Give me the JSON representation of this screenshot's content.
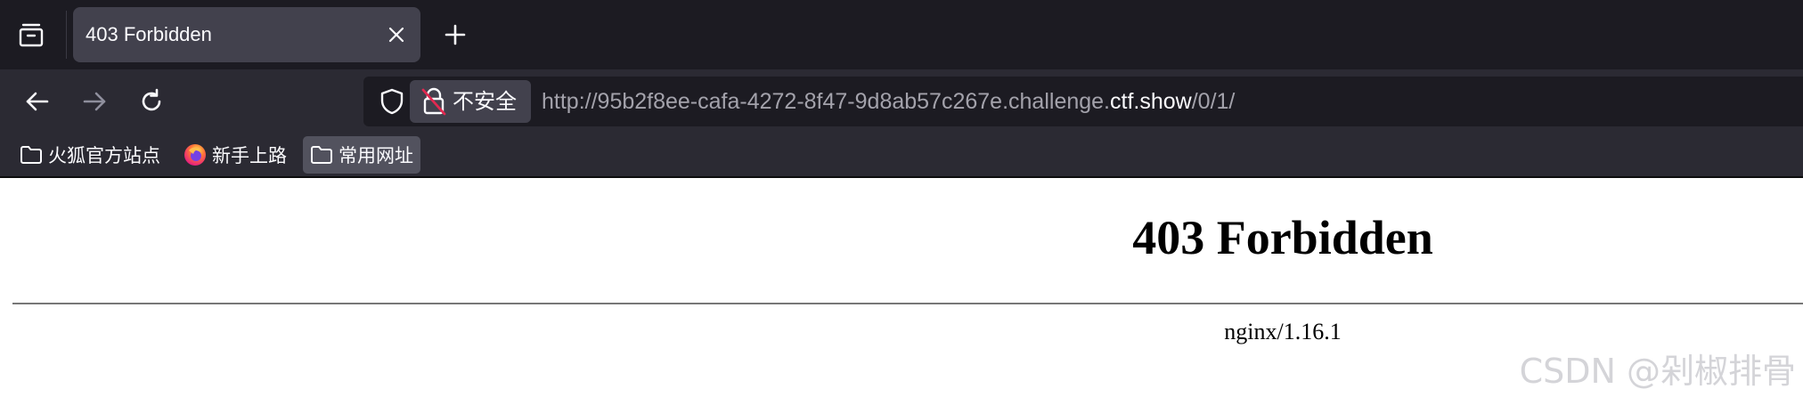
{
  "tab": {
    "title": "403 Forbidden"
  },
  "urlbar": {
    "identity_label": "不安全",
    "url_prefix": "http://95b2f8ee-cafa-4272-8f47-9d8ab57c267e.challenge.",
    "url_domain": "ctf.show",
    "url_suffix": "/0/1/"
  },
  "bookmarks": [
    {
      "label": "火狐官方站点",
      "icon": "folder-icon"
    },
    {
      "label": "新手上路",
      "icon": "firefox-icon"
    },
    {
      "label": "常用网址",
      "icon": "folder-icon"
    }
  ],
  "page": {
    "heading": "403 Forbidden",
    "server": "nginx/1.16.1"
  },
  "watermark": "CSDN @剁椒排骨",
  "colors": {
    "tabbar_bg": "#1c1b22",
    "toolbar_bg": "#2b2a33",
    "active_tab_bg": "#42414d",
    "text_light": "#fbfbfe"
  }
}
